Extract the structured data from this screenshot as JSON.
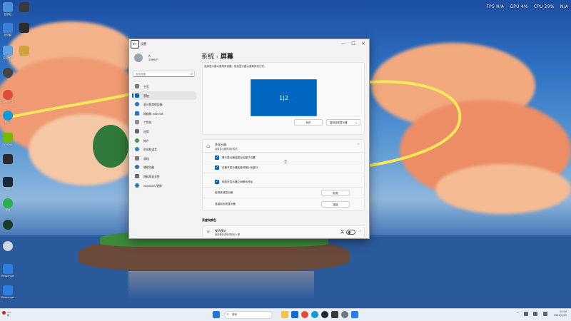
{
  "perf_overlay": {
    "fps": "FPS  N/A",
    "gpu": "GPU  4%",
    "cpu": "CPU  29%",
    "extra": "N/A"
  },
  "desktop_icons": [
    {
      "label": "回收站",
      "color": "#4a90d9"
    },
    {
      "label": "",
      "color": "#3a3a3a"
    },
    {
      "label": "此电脑",
      "color": "#3d7fd8"
    },
    {
      "label": "控制面板",
      "color": "#5fa0e0"
    },
    {
      "label": "",
      "color": "#d0a33a"
    },
    {
      "label": "Microsoft Edge",
      "color": "#1a8fd6"
    },
    {
      "label": "Google Chrome",
      "color": "#e04b3a"
    },
    {
      "label": "Edge",
      "color": "#0f9bd6"
    },
    {
      "label": "NVIDIA",
      "color": "#76b900"
    },
    {
      "label": "",
      "color": "#2b2b2b"
    },
    {
      "label": "Steam",
      "color": "#1b2838"
    },
    {
      "label": "微信",
      "color": "#2ab14a"
    },
    {
      "label": "",
      "color": "#1a3c2a"
    },
    {
      "label": "",
      "color": "#cfd6df"
    },
    {
      "label": "Messenger",
      "color": "#2e7de0"
    },
    {
      "label": "Messenger",
      "color": "#2e7de0"
    }
  ],
  "window": {
    "title": "设置",
    "back_glyph": "←",
    "minimize": "—",
    "maximize": "☐",
    "close": "✕",
    "user": {
      "name": "A",
      "type": "本地帐户"
    },
    "search": {
      "placeholder": "查找设置"
    },
    "nav": [
      {
        "label": "主页",
        "color": "#7a7a7a"
      },
      {
        "label": "系统",
        "color": "#0067c0"
      },
      {
        "label": "蓝牙和其他设备",
        "color": "#1f6fd1"
      },
      {
        "label": "网络和 Internet",
        "color": "#2b73c9"
      },
      {
        "label": "个性化",
        "color": "#8a8a8a"
      },
      {
        "label": "应用",
        "color": "#5a6a80"
      },
      {
        "label": "帐户",
        "color": "#2ca25a"
      },
      {
        "label": "时间和语言",
        "color": "#2f7fd1"
      },
      {
        "label": "游戏",
        "color": "#777777"
      },
      {
        "label": "辅助功能",
        "color": "#2a6fb5"
      },
      {
        "label": "隐私和安全性",
        "color": "#6b6b6b"
      },
      {
        "label": "Windows 更新",
        "color": "#1f78d1"
      }
    ],
    "breadcrumb": {
      "parent": "系统",
      "sep": "›",
      "current": "屏幕"
    },
    "display_card": {
      "description": "选择显示器以更改其设置。拖动显示器以重新排列它们。",
      "monitor_label": "1|2",
      "identify_label": "标识",
      "duplicate_label": "复制这些显示器",
      "duplicate_chevron": "⌄"
    },
    "multi_display": {
      "title": "多显示器",
      "subtitle": "选择显示器的演示模式",
      "collapse_glyph": "⌃",
      "checkboxes": [
        "基于显示器连接记住窗口位置",
        "在断开显示器连接时最小化窗口",
        "轻松在显示器之间移动光标"
      ],
      "rows": [
        {
          "label": "检测其他显示器",
          "button": "检测"
        },
        {
          "label": "连接到无线显示器",
          "button": "连接"
        }
      ]
    },
    "brightness_section": "亮度和颜色",
    "night_light": {
      "title": "夜间模式",
      "subtitle": "使用暖色调来帮助你入睡",
      "state": "关",
      "chevron": "›"
    }
  },
  "taskbar": {
    "weather_line1": "1°C",
    "weather_line2": "阴",
    "search_placeholder": "搜索",
    "tray": [
      "^",
      "wifi",
      "sound",
      "battery"
    ],
    "time": "15:30",
    "date": "2024/1/15"
  }
}
